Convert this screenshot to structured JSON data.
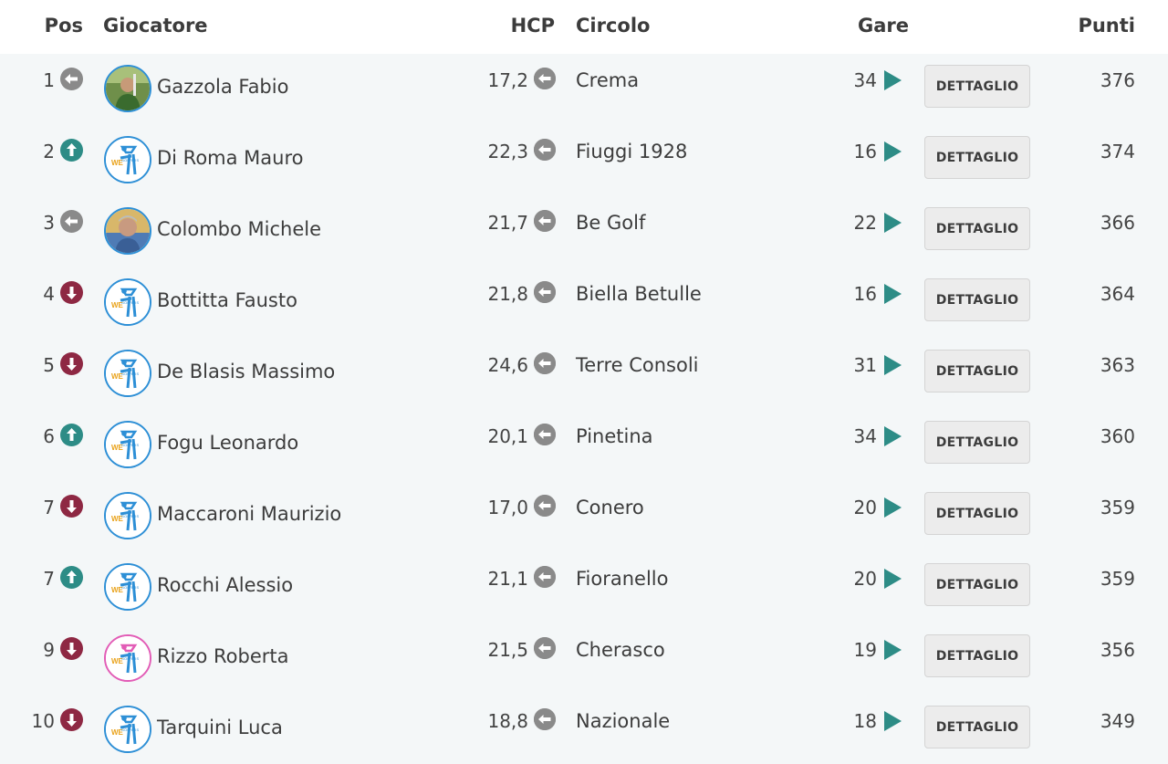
{
  "columns": {
    "pos": "Pos",
    "giocatore": "Giocatore",
    "hcp": "HCP",
    "circolo": "Circolo",
    "gare": "Gare",
    "punti": "Punti"
  },
  "colors": {
    "up": "#2d8c86",
    "down": "#8e2843",
    "neutral": "#8a8a8a",
    "play": "#2d8c86"
  },
  "rows": [
    {
      "pos": "1",
      "trend": "neutral",
      "avatar": "photo-man-green",
      "name": "Gazzola Fabio",
      "hcp": "17,2",
      "circolo": "Crema",
      "gare": "34",
      "button": "DETTAGLIO",
      "punti": "376"
    },
    {
      "pos": "2",
      "trend": "up",
      "avatar": "wegolfers-logo-blue",
      "name": "Di Roma Mauro",
      "hcp": "22,3",
      "circolo": "Fiuggi 1928",
      "gare": "16",
      "button": "DETTAGLIO",
      "punti": "374"
    },
    {
      "pos": "3",
      "trend": "neutral",
      "avatar": "photo-man-gray",
      "name": "Colombo Michele",
      "hcp": "21,7",
      "circolo": "Be Golf",
      "gare": "22",
      "button": "DETTAGLIO",
      "punti": "366"
    },
    {
      "pos": "4",
      "trend": "down",
      "avatar": "wegolfers-logo-blue",
      "name": "Bottitta Fausto",
      "hcp": "21,8",
      "circolo": "Biella Betulle",
      "gare": "16",
      "button": "DETTAGLIO",
      "punti": "364"
    },
    {
      "pos": "5",
      "trend": "down",
      "avatar": "wegolfers-logo-blue",
      "name": "De Blasis Massimo",
      "hcp": "24,6",
      "circolo": "Terre Consoli",
      "gare": "31",
      "button": "DETTAGLIO",
      "punti": "363"
    },
    {
      "pos": "6",
      "trend": "up",
      "avatar": "wegolfers-logo-blue",
      "name": "Fogu Leonardo",
      "hcp": "20,1",
      "circolo": "Pinetina",
      "gare": "34",
      "button": "DETTAGLIO",
      "punti": "360"
    },
    {
      "pos": "7",
      "trend": "down",
      "avatar": "wegolfers-logo-blue",
      "name": "Maccaroni Maurizio",
      "hcp": "17,0",
      "circolo": "Conero",
      "gare": "20",
      "button": "DETTAGLIO",
      "punti": "359"
    },
    {
      "pos": "7",
      "trend": "up",
      "avatar": "wegolfers-logo-blue",
      "name": "Rocchi Alessio",
      "hcp": "21,1",
      "circolo": "Fioranello",
      "gare": "20",
      "button": "DETTAGLIO",
      "punti": "359"
    },
    {
      "pos": "9",
      "trend": "down",
      "avatar": "wegolfers-logo-pink",
      "name": "Rizzo Roberta",
      "hcp": "21,5",
      "circolo": "Cherasco",
      "gare": "19",
      "button": "DETTAGLIO",
      "punti": "356"
    },
    {
      "pos": "10",
      "trend": "down",
      "avatar": "wegolfers-logo-blue",
      "name": "Tarquini Luca",
      "hcp": "18,8",
      "circolo": "Nazionale",
      "gare": "18",
      "button": "DETTAGLIO",
      "punti": "349"
    }
  ]
}
